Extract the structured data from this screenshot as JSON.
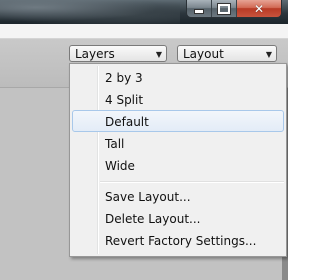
{
  "window": {
    "min_icon": "minimize-icon",
    "max_icon": "maximize-icon",
    "close_icon": "close-icon"
  },
  "toolbar": {
    "layers_label": "Layers",
    "layout_label": "Layout",
    "arrow": "▼"
  },
  "menu": {
    "items": [
      {
        "label": "2 by 3"
      },
      {
        "label": "4 Split"
      },
      {
        "label": "Default",
        "selected": true
      },
      {
        "label": "Tall"
      },
      {
        "label": "Wide"
      },
      {
        "label": "Save Layout..."
      },
      {
        "label": "Delete Layout..."
      },
      {
        "label": "Revert Factory Settings..."
      }
    ]
  },
  "colors": {
    "highlight_border": "#a8c8ea",
    "close_button": "#c8543d"
  }
}
